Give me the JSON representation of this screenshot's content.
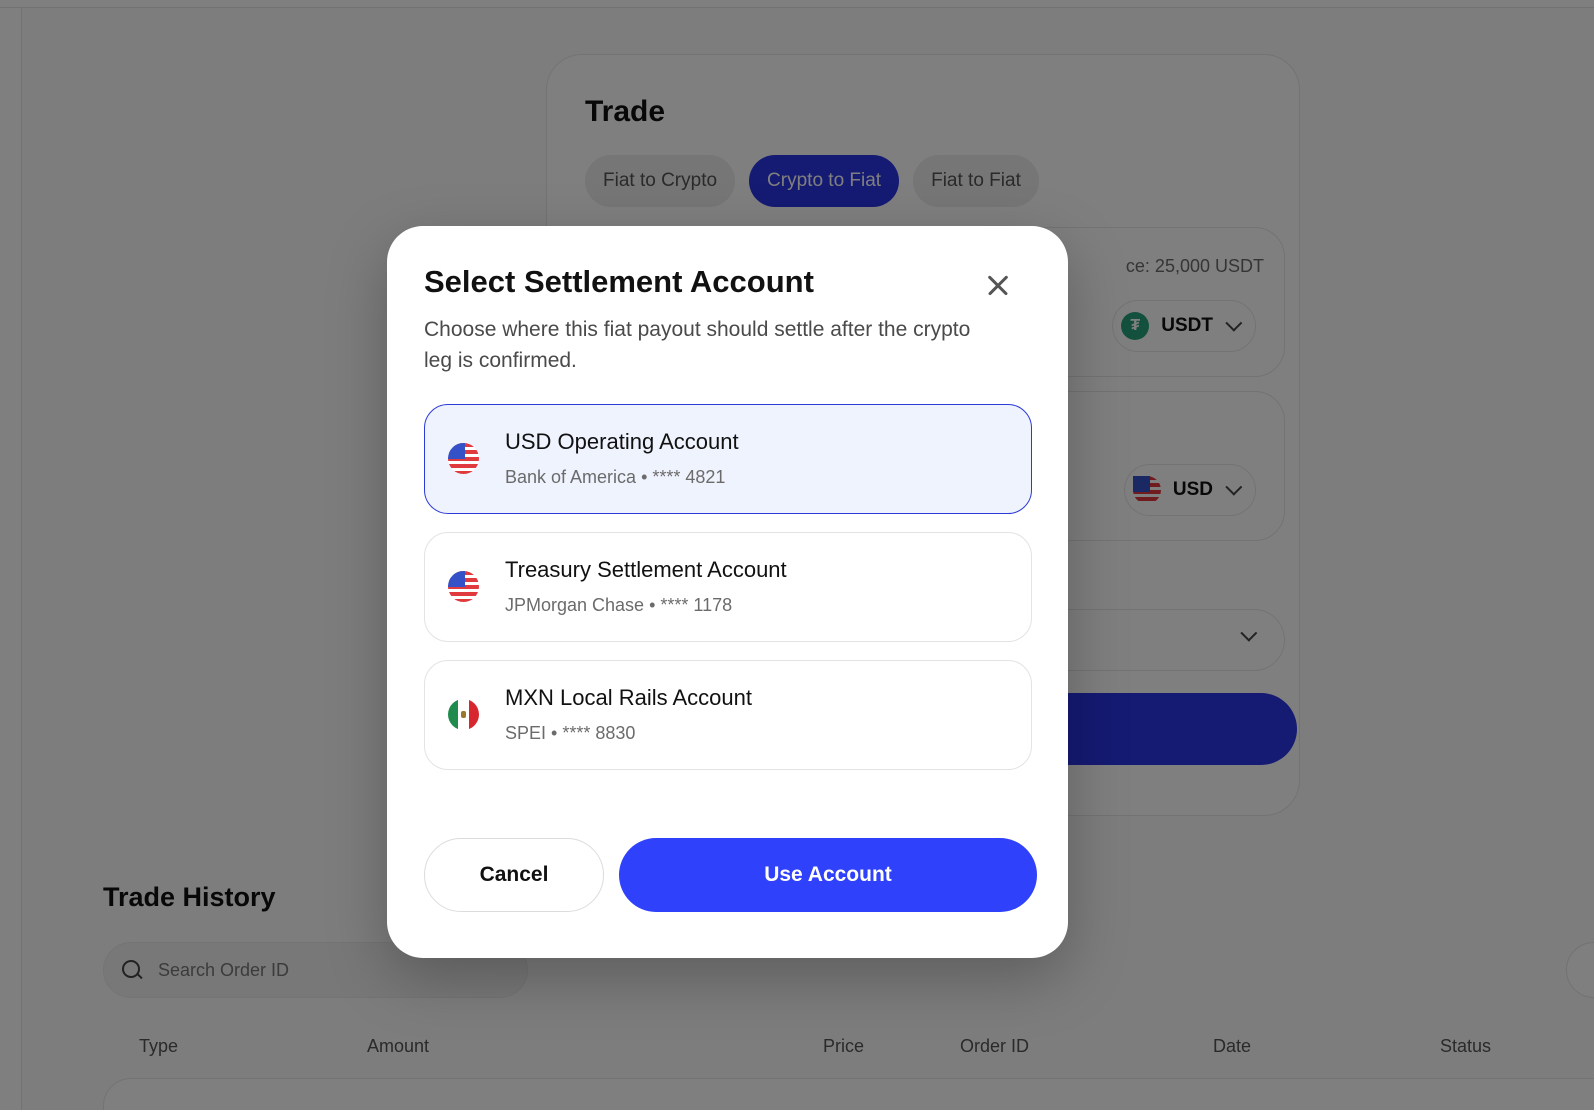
{
  "trade": {
    "title": "Trade",
    "tabs": [
      {
        "label": "Fiat to Crypto",
        "active": false
      },
      {
        "label": "Crypto to Fiat",
        "active": true
      },
      {
        "label": "Fiat to Fiat",
        "active": false
      }
    ],
    "balance_text": "ce: 25,000 USDT",
    "pay_asset": {
      "code": "USDT",
      "icon": "tether-coin-icon"
    },
    "receive_asset": {
      "code": "USD",
      "icon": "us-flag-icon"
    }
  },
  "history": {
    "title": "Trade History",
    "search_placeholder": "Search Order ID",
    "columns": [
      "Type",
      "Amount",
      "Price",
      "Order ID",
      "Date",
      "Status"
    ]
  },
  "modal": {
    "title": "Select Settlement Account",
    "description": "Choose where this fiat payout should settle after the crypto leg is confirmed.",
    "accounts": [
      {
        "name": "USD Operating Account",
        "detail": "Bank of America • **** 4821",
        "flag": "us-flag-icon",
        "selected": true
      },
      {
        "name": "Treasury Settlement Account",
        "detail": "JPMorgan Chase • **** 1178",
        "flag": "us-flag-icon",
        "selected": false
      },
      {
        "name": "MXN Local Rails Account",
        "detail": "SPEI • **** 8830",
        "flag": "mx-flag-icon",
        "selected": false
      }
    ],
    "cancel_label": "Cancel",
    "confirm_label": "Use Account"
  },
  "colors": {
    "accent": "#2f41fb",
    "selected_border": "#2b3bd6",
    "selected_bg": "#eff3fe",
    "overlay": "rgba(0,0,0,0.5)"
  }
}
